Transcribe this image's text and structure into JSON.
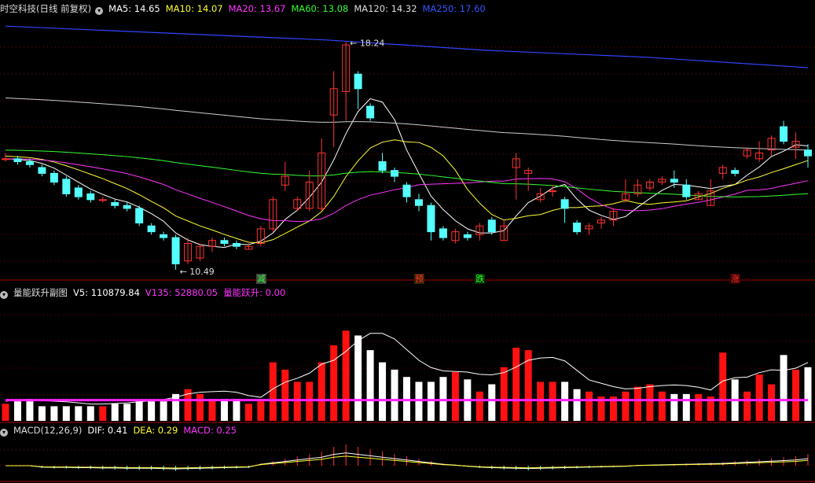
{
  "header": {
    "title": "时空科技(日线 前复权)",
    "ma_items": [
      {
        "label": "MA5: 14.65",
        "color": "#ffffff"
      },
      {
        "label": "MA10: 14.07",
        "color": "#ffff33"
      },
      {
        "label": "MA20: 13.67",
        "color": "#ff33ff"
      },
      {
        "label": "MA60: 13.08",
        "color": "#33ff33"
      },
      {
        "label": "MA120: 14.32",
        "color": "#dddddd"
      },
      {
        "label": "MA250: 17.60",
        "color": "#3355ff"
      }
    ]
  },
  "volume_header": {
    "title": "量能跃升副图",
    "items": [
      {
        "label": "V5: 110879.84",
        "color": "#ffffff"
      },
      {
        "label": "V135: 52880.05",
        "color": "#ff33ff"
      },
      {
        "label": "量能跃升: 0.00",
        "color": "#ff33ff"
      }
    ]
  },
  "macd_header": {
    "title": "MACD(12,26,9)",
    "items": [
      {
        "label": "DIF: 0.41",
        "color": "#ffffff"
      },
      {
        "label": "DEA: 0.29",
        "color": "#ffff33"
      },
      {
        "label": "MACD: 0.25",
        "color": "#ff33ff"
      }
    ]
  },
  "annotations": {
    "high": "18.24",
    "low": "10.49"
  },
  "signals": [
    {
      "text": "减",
      "color": "#33ff33",
      "bg": "#444444",
      "index": 21
    },
    {
      "text": "预",
      "color": "#ff3333",
      "bg": "#3a2200",
      "index": 34
    },
    {
      "text": "跌",
      "color": "#33ff33",
      "bg": "#003300",
      "index": 39
    },
    {
      "text": "涨",
      "color": "#ff3333",
      "bg": "#3a0000",
      "index": 60
    }
  ],
  "colors": {
    "up": "#ff3333",
    "down": "#55ffff",
    "grid": "#7a0000",
    "bg": "#000000"
  },
  "chart_data": {
    "type": "candlestick",
    "price_range": [
      10.2,
      19.2
    ],
    "candles": [
      [
        14.3,
        14.3,
        14.5,
        14.2
      ],
      [
        14.3,
        14.2,
        14.4,
        14.1
      ],
      [
        14.2,
        14.1,
        14.3,
        14.0
      ],
      [
        14.0,
        13.8,
        14.1,
        13.7
      ],
      [
        13.8,
        13.5,
        13.9,
        13.4
      ],
      [
        13.6,
        13.1,
        13.7,
        13.0
      ],
      [
        13.3,
        13.0,
        13.4,
        12.9
      ],
      [
        13.1,
        12.9,
        13.2,
        12.8
      ],
      [
        12.9,
        12.9,
        13.0,
        12.8
      ],
      [
        12.8,
        12.7,
        12.9,
        12.6
      ],
      [
        12.7,
        12.6,
        12.8,
        12.5
      ],
      [
        12.6,
        12.1,
        12.7,
        12.0
      ],
      [
        12.0,
        11.8,
        12.1,
        11.7
      ],
      [
        11.7,
        11.6,
        11.8,
        11.5
      ],
      [
        11.6,
        10.7,
        11.7,
        10.5
      ],
      [
        10.8,
        11.4,
        11.6,
        10.7
      ],
      [
        10.9,
        11.3,
        11.4,
        10.8
      ],
      [
        11.3,
        11.5,
        11.6,
        11.1
      ],
      [
        11.5,
        11.4,
        11.6,
        11.3
      ],
      [
        11.4,
        11.3,
        11.5,
        11.2
      ],
      [
        11.2,
        11.3,
        11.4,
        11.2
      ],
      [
        11.4,
        11.9,
        12.0,
        11.3
      ],
      [
        11.9,
        12.9,
        13.0,
        11.8
      ],
      [
        13.4,
        13.7,
        14.2,
        13.2
      ],
      [
        12.6,
        12.9,
        13.0,
        12.5
      ],
      [
        12.6,
        13.5,
        13.9,
        12.5
      ],
      [
        12.6,
        14.5,
        15.0,
        12.5
      ],
      [
        15.8,
        16.7,
        17.3,
        14.7
      ],
      [
        16.6,
        18.2,
        18.3,
        15.6
      ],
      [
        17.2,
        16.7,
        17.3,
        16.0
      ],
      [
        16.1,
        15.7,
        16.2,
        15.6
      ],
      [
        14.2,
        13.9,
        14.5,
        13.8
      ],
      [
        13.9,
        13.7,
        14.0,
        13.5
      ],
      [
        13.4,
        13.0,
        13.5,
        12.8
      ],
      [
        12.9,
        12.7,
        13.1,
        12.5
      ],
      [
        12.7,
        11.8,
        12.8,
        11.5
      ],
      [
        11.9,
        11.6,
        12.0,
        11.5
      ],
      [
        11.5,
        11.8,
        11.9,
        11.4
      ],
      [
        11.7,
        11.6,
        11.8,
        11.5
      ],
      [
        11.7,
        12.0,
        12.1,
        11.5
      ],
      [
        12.2,
        11.8,
        12.3,
        11.7
      ],
      [
        11.5,
        12.0,
        12.2,
        11.5
      ],
      [
        14.0,
        14.3,
        14.5,
        12.9
      ],
      [
        13.8,
        13.9,
        14.0,
        13.2
      ],
      [
        12.9,
        13.1,
        13.3,
        12.8
      ],
      [
        13.2,
        13.2,
        13.4,
        13.0
      ],
      [
        12.9,
        12.6,
        13.0,
        12.1
      ],
      [
        12.1,
        11.8,
        12.2,
        11.7
      ],
      [
        11.9,
        12.0,
        12.1,
        11.7
      ],
      [
        12.1,
        12.2,
        12.3,
        11.9
      ],
      [
        12.2,
        12.5,
        12.6,
        12.0
      ],
      [
        12.9,
        13.1,
        13.6,
        12.8
      ],
      [
        13.1,
        13.4,
        13.6,
        13.0
      ],
      [
        13.3,
        13.5,
        13.6,
        13.2
      ],
      [
        13.5,
        13.6,
        13.7,
        13.4
      ],
      [
        13.6,
        13.5,
        13.9,
        13.3
      ],
      [
        13.4,
        13.0,
        13.6,
        12.9
      ],
      [
        12.9,
        13.1,
        13.2,
        12.9
      ],
      [
        12.7,
        13.2,
        13.6,
        12.7
      ],
      [
        13.8,
        14.0,
        14.1,
        13.6
      ],
      [
        13.9,
        13.8,
        14.0,
        13.7
      ],
      [
        14.4,
        14.6,
        14.7,
        14.3
      ],
      [
        14.3,
        14.5,
        14.9,
        14.2
      ],
      [
        14.6,
        15.0,
        15.1,
        14.4
      ],
      [
        15.4,
        14.9,
        15.6,
        14.8
      ],
      [
        14.7,
        14.9,
        15.2,
        14.3
      ],
      [
        14.6,
        14.4,
        14.8,
        14.0
      ]
    ],
    "ma250": [
      17.72,
      17.7,
      17.68,
      17.65,
      17.63,
      17.6
    ],
    "volume": {
      "ymax": 5.0,
      "bars": [
        0.7,
        0.8,
        0.8,
        0.6,
        0.6,
        0.6,
        0.6,
        0.6,
        0.6,
        0.7,
        0.7,
        0.8,
        0.8,
        0.8,
        1.1,
        1.3,
        1.1,
        0.9,
        0.9,
        0.9,
        0.7,
        0.8,
        2.4,
        2.1,
        1.6,
        1.6,
        2.4,
        3.1,
        3.7,
        3.5,
        2.9,
        2.4,
        2.1,
        1.8,
        1.6,
        1.6,
        1.8,
        2.0,
        1.7,
        1.2,
        1.5,
        2.2,
        3.0,
        2.9,
        1.6,
        1.6,
        1.6,
        1.3,
        1.2,
        1.0,
        1.0,
        1.2,
        1.4,
        1.5,
        1.2,
        1.1,
        1.1,
        1.1,
        1.0,
        2.8,
        1.7,
        1.2,
        1.9,
        1.5,
        2.7,
        2.1,
        2.2
      ],
      "hi": [
        0.8,
        0.9,
        0.9,
        0.7,
        0.7,
        0.7,
        0.7,
        0.7,
        0.7,
        0.8,
        0.8,
        0.9,
        0.9,
        0.9,
        1.2,
        1.4,
        1.2,
        1.0,
        1.0,
        1.0,
        0.8,
        0.9,
        2.5,
        2.2,
        1.7,
        1.7,
        2.5,
        3.2,
        3.8,
        3.6,
        3.0,
        2.5,
        2.2,
        1.9,
        1.7,
        1.7,
        1.9,
        2.1,
        1.8,
        1.3,
        1.6,
        2.3,
        3.1,
        3.0,
        1.7,
        1.7,
        1.7,
        1.4,
        1.3,
        1.1,
        1.1,
        1.3,
        1.5,
        1.6,
        1.3,
        1.2,
        1.2,
        1.2,
        1.1,
        2.9,
        1.8,
        1.3,
        2.0,
        1.6,
        2.8,
        2.2,
        2.3
      ],
      "v135": 0.85
    },
    "macd": {
      "bars": [
        0,
        0,
        0,
        -0.05,
        -0.06,
        -0.06,
        -0.07,
        -0.07,
        -0.08,
        -0.08,
        -0.09,
        -0.09,
        -0.09,
        -0.1,
        -0.11,
        -0.1,
        -0.09,
        -0.08,
        -0.07,
        -0.06,
        -0.05,
        0.05,
        0.1,
        0.15,
        0.2,
        0.25,
        0.3,
        0.4,
        0.45,
        0.4,
        0.35,
        0.3,
        0.25,
        0.2,
        0.15,
        0.1,
        0.05,
        0.02,
        -0.02,
        -0.05,
        -0.07,
        -0.08,
        -0.09,
        -0.1,
        -0.09,
        -0.08,
        -0.07,
        -0.06,
        -0.05,
        -0.04,
        -0.03,
        -0.02,
        0.01,
        0.02,
        0.03,
        0.04,
        0.05,
        0.06,
        0.07,
        0.08,
        0.1,
        0.12,
        0.14,
        0.16,
        0.18,
        0.2,
        0.25
      ],
      "range": [
        -0.3,
        0.6
      ]
    }
  }
}
